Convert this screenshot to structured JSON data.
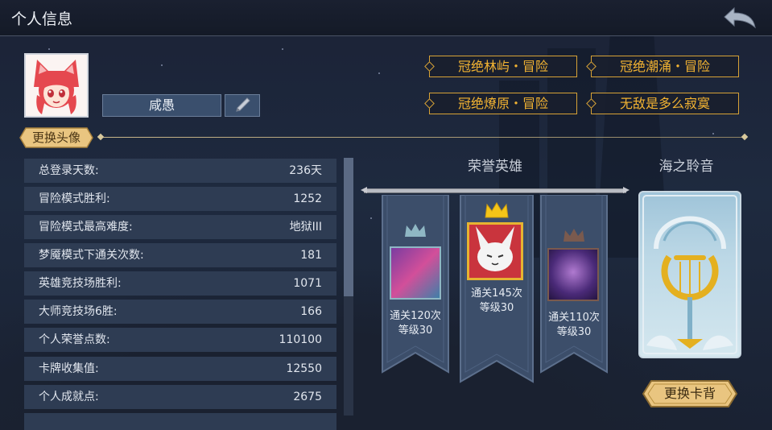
{
  "header": {
    "title": "个人信息"
  },
  "profile": {
    "name": "咸愚",
    "change_avatar_label": "更换头像"
  },
  "tags": [
    "冠绝林屿・冒险",
    "冠绝潮涌・冒险",
    "冠绝燎原・冒险",
    "无敌是多么寂寞"
  ],
  "stats": [
    {
      "label": "总登录天数:",
      "value": "236天"
    },
    {
      "label": "冒险模式胜利:",
      "value": "1252"
    },
    {
      "label": "冒险模式最高难度:",
      "value": "地狱III"
    },
    {
      "label": "梦魇模式下通关次数:",
      "value": "181"
    },
    {
      "label": "英雄竞技场胜利:",
      "value": "1071"
    },
    {
      "label": "大师竞技场6胜:",
      "value": "166"
    },
    {
      "label": "个人荣誉点数:",
      "value": "110100"
    },
    {
      "label": "卡牌收集值:",
      "value": "12550"
    },
    {
      "label": "个人成就点:",
      "value": "2675"
    }
  ],
  "honor": {
    "title": "荣誉英雄",
    "heroes": [
      {
        "line1": "通关120次",
        "line2": "等级30",
        "crown": "silver"
      },
      {
        "line1": "通关145次",
        "line2": "等级30",
        "crown": "gold"
      },
      {
        "line1": "通关110次",
        "line2": "等级30",
        "crown": "bronze"
      }
    ]
  },
  "cardback": {
    "title": "海之聆音",
    "change_label": "更换卡背"
  },
  "colors": {
    "gold": "#f2b332",
    "panel": "#2e3c53",
    "gold_crown": "#f5c518",
    "silver_crown": "#8fb7c4",
    "bronze_crown": "#7a5a4e"
  }
}
